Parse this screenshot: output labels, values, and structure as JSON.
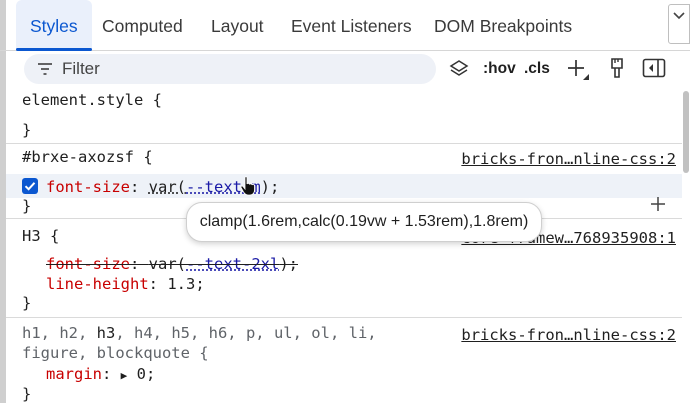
{
  "tabs": [
    {
      "label": "Styles",
      "active": true
    },
    {
      "label": "Computed"
    },
    {
      "label": "Layout"
    },
    {
      "label": "Event Listeners"
    },
    {
      "label": "DOM Breakpoints"
    }
  ],
  "toolbar": {
    "filter_placeholder": "Filter",
    "hov_label": ":hov",
    "cls_label": ".cls"
  },
  "icons": {
    "filter": "filter-lines-icon",
    "layers": "layers-icon",
    "add": "plus-icon",
    "pin": "paint-brush-icon",
    "sidebar": "toggle-sidebar-icon",
    "overflow": "chevron-down-icon"
  },
  "rules": {
    "element_style": {
      "open": "element.style {",
      "close": "}"
    },
    "brxe": {
      "selector": "#brxe-axozsf {",
      "source": "bricks-fron…nline-css:2",
      "decl_prop": "font-size",
      "decl_colon": ": ",
      "decl_fn": "var(",
      "decl_var": "--text-m",
      "decl_end": ");",
      "close": "}"
    },
    "h3": {
      "selector": "H3 {",
      "source": "core-framew…768935908:1",
      "struck_prop": "font-size",
      "struck_colon": ": ",
      "struck_fn": "var(",
      "struck_var": "--text-2xl",
      "struck_end": ");",
      "lh_prop": "line-height",
      "lh_val": ": 1.3;",
      "close": "}"
    },
    "headings": {
      "selector_a": "h1, h2, ",
      "selector_h3": "h3",
      "selector_b": ", h4, h5, h6, p, ul, ol, li,",
      "selector_line2": "figure, blockquote {",
      "source": "bricks-fron…nline-css:2",
      "margin_prop": "margin",
      "margin_colon": ": ",
      "margin_arrow": "▶",
      "margin_val": " 0;",
      "close": "}"
    }
  },
  "tooltip": {
    "text": "clamp(1.6rem,calc(0.19vw + 1.53rem),1.8rem)"
  },
  "colors": {
    "accent": "#0b57d0",
    "property": "#c80000",
    "variable": "#1a1aa6"
  }
}
